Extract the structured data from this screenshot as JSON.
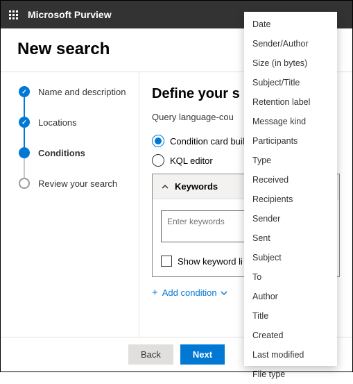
{
  "header": {
    "product": "Microsoft Purview"
  },
  "page_title": "New search",
  "stepper": {
    "items": [
      {
        "label": "Name and description"
      },
      {
        "label": "Locations"
      },
      {
        "label": "Conditions"
      },
      {
        "label": "Review your search"
      }
    ]
  },
  "main": {
    "heading": "Define your s",
    "subtitle": "Query language-cou",
    "radio_builder": "Condition card buil",
    "radio_kql": "KQL editor",
    "keywords_header": "Keywords",
    "keywords_placeholder": "Enter keywords",
    "show_keyword_list": "Show keyword li",
    "add_condition": "Add condition"
  },
  "footer": {
    "back": "Back",
    "next": "Next"
  },
  "dropdown": {
    "items": [
      "Date",
      "Sender/Author",
      "Size (in bytes)",
      "Subject/Title",
      "Retention label",
      "Message kind",
      "Participants",
      "Type",
      "Received",
      "Recipients",
      "Sender",
      "Sent",
      "Subject",
      "To",
      "Author",
      "Title",
      "Created",
      "Last modified",
      "File type"
    ]
  }
}
